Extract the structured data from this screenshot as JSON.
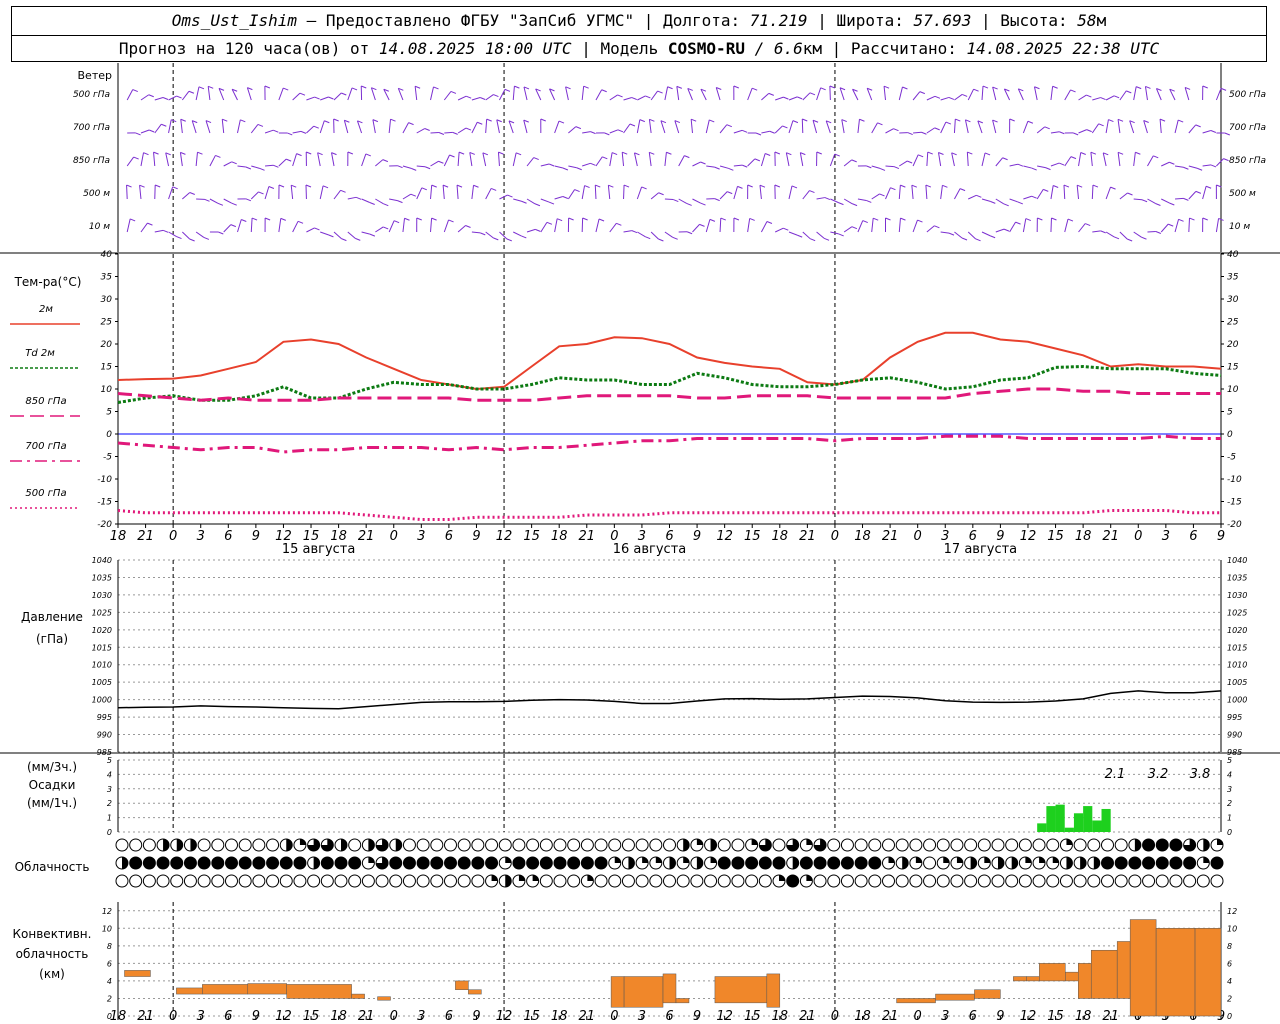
{
  "header": {
    "station": "Oms_Ust_Ishim",
    "provided": " – Предоставлено ФГБУ \"ЗапСиб УГМС\" | Долгота: ",
    "lon": "71.219",
    "lat_label": " | Широта: ",
    "lat": "57.693",
    "alt_label": " | Высота: ",
    "alt": "58",
    "alt_unit": "м",
    "forecast_label": "Прогноз на 120 часа(ов) от ",
    "forecast_from": "14.08.2025 18:00 UTC",
    "model_label": " | Модель ",
    "model": "COSMO-RU",
    "model_res": " / 6.6",
    "model_res_unit": "км",
    "computed_label": " | Рассчитано: ",
    "computed": "14.08.2025 22:38 UTC"
  },
  "time_axis": {
    "hours": [
      "18",
      "21",
      "0",
      "3",
      "6",
      "9",
      "12",
      "15",
      "18",
      "21",
      "0",
      "3",
      "6",
      "9",
      "12",
      "15",
      "18",
      "21",
      "0",
      "3",
      "6",
      "9",
      "12",
      "15",
      "18",
      "21",
      "0"
    ],
    "dates": [
      "15 августа",
      "16 августа",
      "17 августа"
    ]
  },
  "wind": {
    "title": "Ветер",
    "levels": [
      "500 гПа",
      "700 гПа",
      "850 гПа",
      "500 м",
      "10 м"
    ],
    "color": "#7b2fd0"
  },
  "temp": {
    "title": "Тем-ра(°C)",
    "ticks": [
      "40",
      "35",
      "30",
      "25",
      "20",
      "15",
      "10",
      "5",
      "0",
      "-5",
      "-10",
      "-15",
      "-20"
    ],
    "legend": [
      {
        "label": "2м",
        "color": "#e8402c"
      },
      {
        "label": "Td 2м",
        "color": "#0c7a12"
      },
      {
        "label": "850 гПа",
        "color": "#e0187a"
      },
      {
        "label": "700 гПа",
        "color": "#e0187a"
      },
      {
        "label": "500 гПа",
        "color": "#e0187a"
      }
    ]
  },
  "pressure": {
    "title1": "Давление",
    "title2": "(гПа)",
    "ticks": [
      "1040",
      "1035",
      "1030",
      "1025",
      "1020",
      "1015",
      "1010",
      "1005",
      "1000",
      "995",
      "990",
      "985"
    ]
  },
  "precip": {
    "title1": "(мм/3ч.)",
    "title2": "Осадки",
    "title3": "(мм/1ч.)",
    "ticks": [
      "5",
      "4",
      "3",
      "2",
      "1",
      "0"
    ],
    "totals": [
      "2.1",
      "3.2",
      "3.8"
    ],
    "color": "#1ed01e"
  },
  "cloud": {
    "title": "Облачность"
  },
  "conv": {
    "title1": "Конвективн.",
    "title2": "облачность",
    "title3": "(км)",
    "ticks": [
      "12",
      "10",
      "8",
      "6",
      "4",
      "2",
      "0"
    ],
    "color": "#f0872a"
  },
  "chart_data": {
    "type": "line",
    "x_hours_from_start": [
      0,
      3,
      6,
      9,
      12,
      15,
      18,
      21,
      24,
      27,
      30,
      33,
      36,
      39,
      42,
      45,
      48,
      51,
      54,
      57,
      60,
      63,
      66,
      69,
      72,
      75,
      78,
      81,
      84,
      87,
      90,
      93,
      96,
      99,
      102,
      105,
      108,
      111,
      114,
      117,
      120
    ],
    "series": [
      {
        "name": "2м",
        "values": [
          12,
          12.2,
          12.3,
          13,
          14.5,
          16,
          20.5,
          21,
          20,
          17,
          14.5,
          12,
          11,
          10,
          10.5,
          15,
          19.5,
          20,
          21.5,
          21.3,
          20,
          17,
          15.8,
          15,
          14.5,
          11.5,
          11,
          12,
          17,
          20.5,
          22.5,
          22.5,
          21,
          20.5,
          19,
          17.5,
          15,
          15.5,
          15,
          15,
          14.5
        ]
      },
      {
        "name": "Td 2м",
        "values": [
          7,
          8,
          8.5,
          7.5,
          7.5,
          8.5,
          10.5,
          8,
          8,
          10,
          11.5,
          11,
          11,
          10,
          10,
          11,
          12.5,
          12,
          12,
          11,
          11,
          13.5,
          12.5,
          11,
          10.5,
          10.5,
          11,
          12,
          12.5,
          11.5,
          10,
          10.5,
          12,
          12.5,
          14.8,
          15,
          14.5,
          14.5,
          14.5,
          13.5,
          13
        ]
      },
      {
        "name": "850 гПа",
        "values": [
          9,
          8.5,
          8,
          7.5,
          8,
          7.5,
          7.5,
          7.5,
          8,
          8,
          8,
          8,
          8,
          7.5,
          7.5,
          7.5,
          8,
          8.5,
          8.5,
          8.5,
          8.5,
          8,
          8,
          8.5,
          8.5,
          8.5,
          8,
          8,
          8,
          8,
          8,
          9,
          9.5,
          10,
          10,
          9.5,
          9.5,
          9,
          9,
          9,
          9
        ]
      },
      {
        "name": "700 гПа",
        "values": [
          -2,
          -2.5,
          -3,
          -3.5,
          -3,
          -3,
          -4,
          -3.5,
          -3.5,
          -3,
          -3,
          -3,
          -3.5,
          -3,
          -3.5,
          -3,
          -3,
          -2.5,
          -2,
          -1.5,
          -1.5,
          -1,
          -1,
          -1,
          -1,
          -1,
          -1.5,
          -1,
          -1,
          -1,
          -0.5,
          -0.5,
          -0.5,
          -1,
          -1,
          -1,
          -1,
          -1,
          -0.5,
          -1,
          -1
        ]
      },
      {
        "name": "500 гПа",
        "values": [
          -17,
          -17.5,
          -17.5,
          -17.5,
          -17.5,
          -17.5,
          -17.5,
          -17.5,
          -17.5,
          -18,
          -18.5,
          -19,
          -19,
          -18.5,
          -18.5,
          -18.5,
          -18.5,
          -18,
          -18,
          -18,
          -17.5,
          -17.5,
          -17.5,
          -17.5,
          -17.5,
          -17.5,
          -17.5,
          -17.5,
          -17.5,
          -17.5,
          -17.5,
          -17.5,
          -17.5,
          -17.5,
          -17.5,
          -17.5,
          -17,
          -17,
          -17,
          -17.5,
          -17.5
        ]
      },
      {
        "name": "Давление",
        "values": [
          997.7,
          997.8,
          997.9,
          998.2,
          998,
          997.9,
          997.7,
          997.5,
          997.4,
          998,
          998.6,
          999.2,
          999.4,
          999.4,
          999.5,
          999.8,
          1000,
          999.9,
          999.5,
          998.9,
          998.9,
          999.6,
          1000.2,
          1000.3,
          1000.1,
          1000.2,
          1000.6,
          1001,
          1000.9,
          1000.5,
          999.7,
          999.3,
          999.2,
          999.3,
          999.6,
          1000.2,
          1001.8,
          1002.5,
          1002,
          1002,
          1002.5
        ]
      }
    ],
    "precip_mm_1h": [
      0,
      0,
      0,
      0,
      0,
      0,
      0,
      0,
      0,
      0,
      0,
      0,
      0,
      0,
      0,
      0,
      0,
      0,
      0,
      0,
      0,
      0,
      0,
      0,
      0,
      0,
      0,
      0,
      0,
      0,
      0,
      0,
      0,
      0,
      0,
      0,
      0,
      0,
      0,
      0,
      0,
      0,
      0,
      0,
      0,
      0,
      0,
      0,
      0,
      0,
      0,
      0,
      0,
      0,
      0,
      0,
      0,
      0,
      0,
      0,
      0,
      0,
      0,
      0,
      0,
      0,
      0,
      0,
      0,
      0,
      0,
      0,
      0,
      0,
      0,
      0,
      0,
      0,
      0,
      0,
      0,
      0,
      0,
      0,
      0,
      0,
      0,
      0,
      0,
      0,
      0,
      0,
      0,
      0,
      0,
      0,
      0,
      0,
      0,
      0,
      0.6,
      1.8,
      1.9,
      0.3,
      1.3,
      1.8,
      0.8,
      1.6
    ],
    "convective_km": [
      {
        "x0": 0.5,
        "x1": 2.5,
        "base": 4.5,
        "top": 5.2
      },
      {
        "x0": 4.5,
        "x1": 6.5,
        "base": 2.5,
        "top": 3.2
      },
      {
        "x0": 6.5,
        "x1": 10,
        "base": 2.5,
        "top": 3.6
      },
      {
        "x0": 10,
        "x1": 13,
        "base": 2.5,
        "top": 3.7
      },
      {
        "x0": 13,
        "x1": 18,
        "base": 2,
        "top": 3.6
      },
      {
        "x0": 18,
        "x1": 19,
        "base": 2,
        "top": 2.5
      },
      {
        "x0": 20,
        "x1": 21,
        "base": 1.8,
        "top": 2.2
      },
      {
        "x0": 26,
        "x1": 27,
        "base": 3,
        "top": 4
      },
      {
        "x0": 27,
        "x1": 28,
        "base": 2.5,
        "top": 3
      },
      {
        "x0": 38,
        "x1": 39,
        "base": 1,
        "top": 4.5
      },
      {
        "x0": 39,
        "x1": 42,
        "base": 1,
        "top": 4.5
      },
      {
        "x0": 42,
        "x1": 43,
        "base": 1.5,
        "top": 4.8
      },
      {
        "x0": 43,
        "x1": 44,
        "base": 1.5,
        "top": 2
      },
      {
        "x0": 46,
        "x1": 50,
        "base": 1.5,
        "top": 4.5
      },
      {
        "x0": 50,
        "x1": 51,
        "base": 1,
        "top": 4.8
      },
      {
        "x0": 60,
        "x1": 63,
        "base": 1.5,
        "top": 2
      },
      {
        "x0": 63,
        "x1": 66,
        "base": 1.8,
        "top": 2.5
      },
      {
        "x0": 66,
        "x1": 68,
        "base": 2,
        "top": 3
      },
      {
        "x0": 69,
        "x1": 70,
        "base": 4,
        "top": 4.5
      },
      {
        "x0": 70,
        "x1": 71,
        "base": 4,
        "top": 4.5
      },
      {
        "x0": 71,
        "x1": 73,
        "base": 4,
        "top": 6
      },
      {
        "x0": 73,
        "x1": 74,
        "base": 4,
        "top": 5
      },
      {
        "x0": 74,
        "x1": 75,
        "base": 2,
        "top": 6
      },
      {
        "x0": 75,
        "x1": 77,
        "base": 2,
        "top": 7.5
      },
      {
        "x0": 77,
        "x1": 78,
        "base": 2,
        "top": 8.5
      },
      {
        "x0": 78,
        "x1": 80,
        "base": 0,
        "top": 11
      },
      {
        "x0": 80,
        "x1": 83,
        "base": 0,
        "top": 10
      },
      {
        "x0": 83,
        "x1": 85,
        "base": 0,
        "top": 10
      }
    ],
    "cloud_rows": [
      "OOOHHHOOOOOOHQTTHOHTHOOOOOOOOOOOOOOOOOOOOHQHOOQTOTQTOOOOOOOOOOOOOOOOOQOOOOHFFFTHQHHHTQTTFHHTTFFFFFFFFFFFFFFFFFF",
      "HFFFFFFFFFFFFFHFFFQTFFFFFFFFQFFFFFFFQHQQHQHQFFFFFHFFFFFFQHQOQQHQHHQQQHHHFFFFFFFQFFFFFFFFFFFFFFFFFFFFFFFFFFFFFFFF",
      "OOOOOOOOOOOOOOOOOOOOOOOOOOOQHQQOOOQOOOOOOOOOOOOOQFQOOOOOOOOOOOOOOOOOOOOOOOOOOOOOOOOOOOOOOOOOOOOOOOOOOHFHHHHHHQF"
    ],
    "ylim_temp": [
      -20,
      40
    ],
    "ylim_pressure": [
      985,
      1040
    ],
    "ylim_precip": [
      0,
      5
    ],
    "ylim_conv": [
      0,
      13
    ]
  }
}
